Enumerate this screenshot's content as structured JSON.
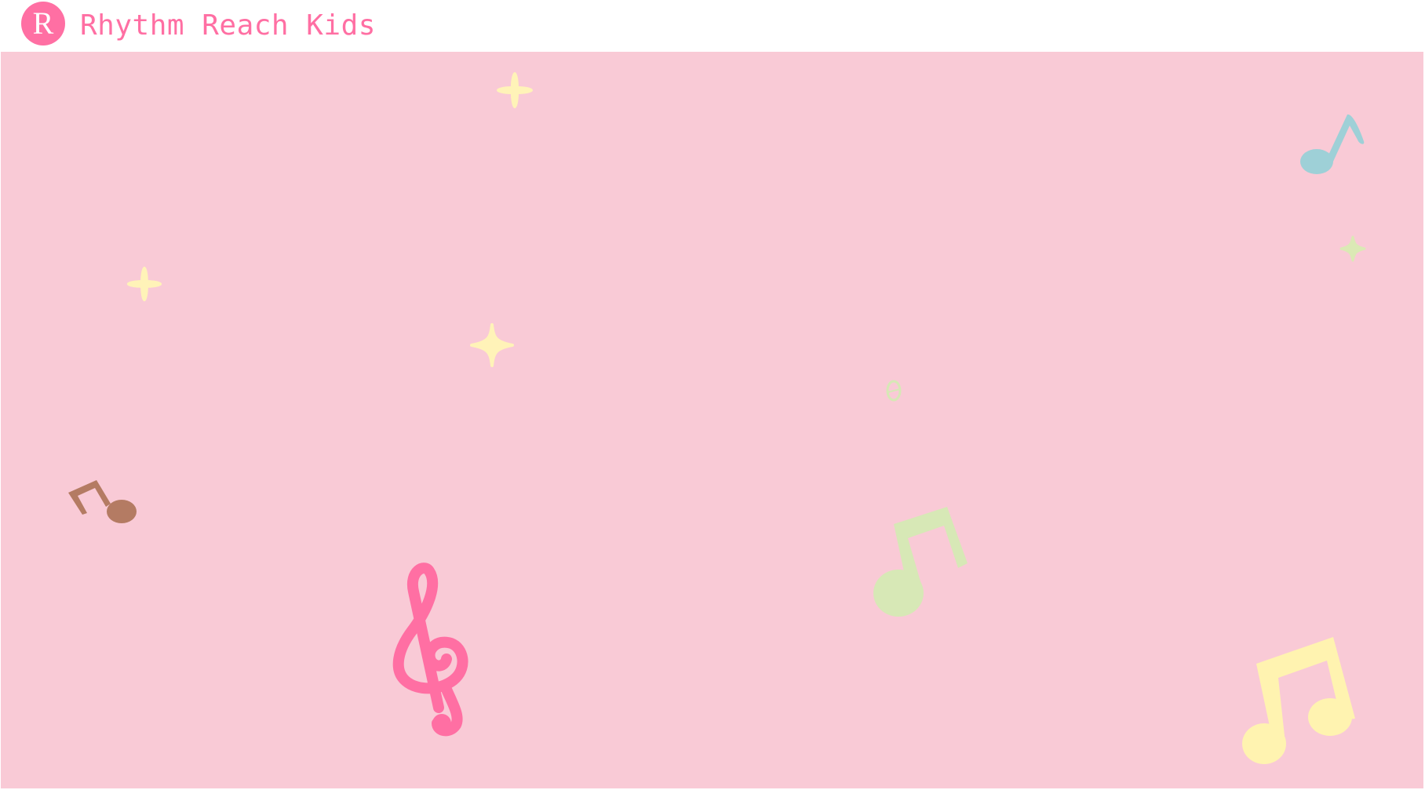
{
  "header": {
    "logo_letter": "R",
    "brand_name": "Rhythm Reach Kids"
  },
  "stage": {
    "background_color": "#f9cad6",
    "decorations": [
      {
        "name": "sparkle-icon",
        "color": "#fff3b8"
      },
      {
        "name": "sparkle-icon",
        "color": "#fff3b8"
      },
      {
        "name": "sparkle-icon",
        "color": "#fff3b8"
      },
      {
        "name": "sparkle-icon",
        "color": "#dbe9b5"
      },
      {
        "name": "eighth-note-icon",
        "color": "#9ed0d7"
      },
      {
        "name": "eighth-note-icon",
        "color": "#b47b63"
      },
      {
        "name": "treble-clef-icon",
        "color": "#ff6fa3"
      },
      {
        "name": "eighth-note-icon",
        "color": "#d7e8b6"
      },
      {
        "name": "whole-note-icon",
        "color": "#d7e8b6"
      },
      {
        "name": "beamed-notes-icon",
        "color": "#fff3b0"
      }
    ]
  },
  "colors": {
    "accent": "#ff6fa3",
    "header_bg": "#ffffff"
  }
}
